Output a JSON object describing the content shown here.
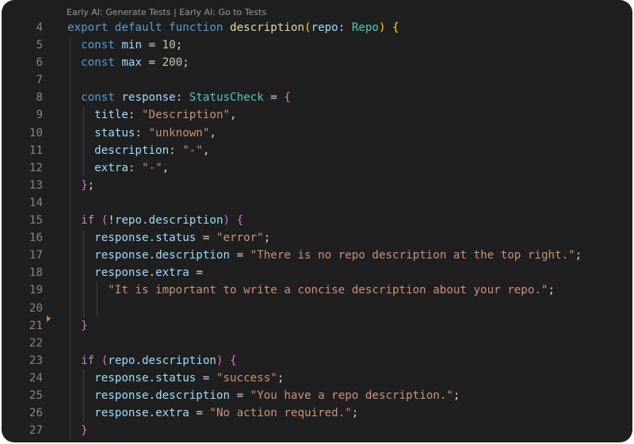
{
  "codelens": {
    "generate_tests": "Early AI: Generate Tests",
    "separator": " | ",
    "go_to_tests": "Early AI: Go to Tests"
  },
  "lines": [
    {
      "n": "4",
      "tokens": [
        [
          "kw",
          "export"
        ],
        [
          "pun",
          " "
        ],
        [
          "kw",
          "default"
        ],
        [
          "pun",
          " "
        ],
        [
          "kw",
          "function"
        ],
        [
          "pun",
          " "
        ],
        [
          "fn",
          "description"
        ],
        [
          "br1",
          "("
        ],
        [
          "var",
          "repo"
        ],
        [
          "pun",
          ": "
        ],
        [
          "ty",
          "Repo"
        ],
        [
          "br1",
          ")"
        ],
        [
          "pun",
          " "
        ],
        [
          "br1",
          "{"
        ]
      ]
    },
    {
      "n": "5",
      "tokens": [
        [
          "pun",
          "  "
        ],
        [
          "kw",
          "const"
        ],
        [
          "pun",
          " "
        ],
        [
          "var",
          "min"
        ],
        [
          "pun",
          " = "
        ],
        [
          "num",
          "10"
        ],
        [
          "pun",
          ";"
        ]
      ]
    },
    {
      "n": "6",
      "tokens": [
        [
          "pun",
          "  "
        ],
        [
          "kw",
          "const"
        ],
        [
          "pun",
          " "
        ],
        [
          "var",
          "max"
        ],
        [
          "pun",
          " = "
        ],
        [
          "num",
          "200"
        ],
        [
          "pun",
          ";"
        ]
      ]
    },
    {
      "n": "7",
      "tokens": []
    },
    {
      "n": "8",
      "tokens": [
        [
          "pun",
          "  "
        ],
        [
          "kw",
          "const"
        ],
        [
          "pun",
          " "
        ],
        [
          "var",
          "response"
        ],
        [
          "pun",
          ": "
        ],
        [
          "ty",
          "StatusCheck"
        ],
        [
          "pun",
          " = "
        ],
        [
          "br2",
          "{"
        ]
      ]
    },
    {
      "n": "9",
      "tokens": [
        [
          "pun",
          "    "
        ],
        [
          "var",
          "title"
        ],
        [
          "pun",
          ": "
        ],
        [
          "str",
          "\"Description\""
        ],
        [
          "pun",
          ","
        ]
      ]
    },
    {
      "n": "10",
      "tokens": [
        [
          "pun",
          "    "
        ],
        [
          "var",
          "status"
        ],
        [
          "pun",
          ": "
        ],
        [
          "str",
          "\"unknown\""
        ],
        [
          "pun",
          ","
        ]
      ]
    },
    {
      "n": "11",
      "tokens": [
        [
          "pun",
          "    "
        ],
        [
          "var",
          "description"
        ],
        [
          "pun",
          ": "
        ],
        [
          "str",
          "\"-\""
        ],
        [
          "pun",
          ","
        ]
      ]
    },
    {
      "n": "12",
      "tokens": [
        [
          "pun",
          "    "
        ],
        [
          "var",
          "extra"
        ],
        [
          "pun",
          ": "
        ],
        [
          "str",
          "\"-\""
        ],
        [
          "pun",
          ","
        ]
      ]
    },
    {
      "n": "13",
      "tokens": [
        [
          "pun",
          "  "
        ],
        [
          "br2",
          "}"
        ],
        [
          "pun",
          ";"
        ]
      ]
    },
    {
      "n": "14",
      "tokens": []
    },
    {
      "n": "15",
      "tokens": [
        [
          "pun",
          "  "
        ],
        [
          "ctl",
          "if"
        ],
        [
          "pun",
          " "
        ],
        [
          "br2",
          "("
        ],
        [
          "pun",
          "!"
        ],
        [
          "var",
          "repo"
        ],
        [
          "pun",
          "."
        ],
        [
          "var",
          "description"
        ],
        [
          "br2",
          ")"
        ],
        [
          "pun",
          " "
        ],
        [
          "br2",
          "{"
        ]
      ]
    },
    {
      "n": "16",
      "tokens": [
        [
          "pun",
          "    "
        ],
        [
          "var",
          "response"
        ],
        [
          "pun",
          "."
        ],
        [
          "var",
          "status"
        ],
        [
          "pun",
          " = "
        ],
        [
          "str",
          "\"error\""
        ],
        [
          "pun",
          ";"
        ]
      ]
    },
    {
      "n": "17",
      "tokens": [
        [
          "pun",
          "    "
        ],
        [
          "var",
          "response"
        ],
        [
          "pun",
          "."
        ],
        [
          "var",
          "description"
        ],
        [
          "pun",
          " = "
        ],
        [
          "str",
          "\"There is no repo description at the top right.\""
        ],
        [
          "pun",
          ";"
        ]
      ]
    },
    {
      "n": "18",
      "tokens": [
        [
          "pun",
          "    "
        ],
        [
          "var",
          "response"
        ],
        [
          "pun",
          "."
        ],
        [
          "var",
          "extra"
        ],
        [
          "pun",
          " ="
        ]
      ]
    },
    {
      "n": "19",
      "tokens": [
        [
          "pun",
          "      "
        ],
        [
          "str",
          "\"It is important to write a concise description about your repo.\""
        ],
        [
          "pun",
          ";"
        ]
      ]
    },
    {
      "n": "20",
      "tokens": []
    },
    {
      "n": "21",
      "tokens": [
        [
          "pun",
          "  "
        ],
        [
          "br2",
          "}"
        ]
      ]
    },
    {
      "n": "22",
      "tokens": []
    },
    {
      "n": "23",
      "tokens": [
        [
          "pun",
          "  "
        ],
        [
          "ctl",
          "if"
        ],
        [
          "pun",
          " "
        ],
        [
          "br2",
          "("
        ],
        [
          "var",
          "repo"
        ],
        [
          "pun",
          "."
        ],
        [
          "var",
          "description"
        ],
        [
          "br2",
          ")"
        ],
        [
          "pun",
          " "
        ],
        [
          "br2",
          "{"
        ]
      ]
    },
    {
      "n": "24",
      "tokens": [
        [
          "pun",
          "    "
        ],
        [
          "var",
          "response"
        ],
        [
          "pun",
          "."
        ],
        [
          "var",
          "status"
        ],
        [
          "pun",
          " = "
        ],
        [
          "str",
          "\"success\""
        ],
        [
          "pun",
          ";"
        ]
      ]
    },
    {
      "n": "25",
      "tokens": [
        [
          "pun",
          "    "
        ],
        [
          "var",
          "response"
        ],
        [
          "pun",
          "."
        ],
        [
          "var",
          "description"
        ],
        [
          "pun",
          " = "
        ],
        [
          "str",
          "\"You have a repo description.\""
        ],
        [
          "pun",
          ";"
        ]
      ]
    },
    {
      "n": "26",
      "tokens": [
        [
          "pun",
          "    "
        ],
        [
          "var",
          "response"
        ],
        [
          "pun",
          "."
        ],
        [
          "var",
          "extra"
        ],
        [
          "pun",
          " = "
        ],
        [
          "str",
          "\"No action required.\""
        ],
        [
          "pun",
          ";"
        ]
      ]
    },
    {
      "n": "27",
      "tokens": [
        [
          "pun",
          "  "
        ],
        [
          "br2",
          "}"
        ]
      ]
    }
  ]
}
